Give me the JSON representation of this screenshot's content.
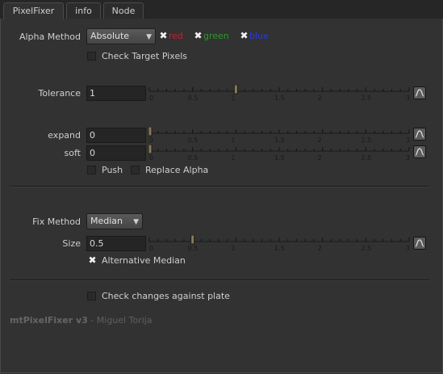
{
  "tabs": [
    {
      "label": "PixelFixer",
      "active": true
    },
    {
      "label": "info",
      "active": false
    },
    {
      "label": "Node",
      "active": false
    }
  ],
  "alpha_method": {
    "label": "Alpha Method",
    "value": "Absolute",
    "channels": [
      {
        "label": "red",
        "checked": true,
        "color": "#c8202a"
      },
      {
        "label": "green",
        "checked": true,
        "color": "#2a9a2a"
      },
      {
        "label": "blue",
        "checked": true,
        "color": "#2a3ad8"
      }
    ]
  },
  "check_target_pixels": {
    "label": "Check Target Pixels",
    "checked": false
  },
  "tolerance": {
    "label": "Tolerance",
    "value": "1"
  },
  "expand": {
    "label": "expand",
    "value": "0"
  },
  "soft": {
    "label": "soft",
    "value": "0"
  },
  "push": {
    "label": "Push",
    "checked": false
  },
  "replace_alpha": {
    "label": "Replace Alpha",
    "checked": false
  },
  "fix_method": {
    "label": "Fix Method",
    "value": "Median"
  },
  "size": {
    "label": "Size",
    "value": "0.5"
  },
  "alternative_median": {
    "label": "Alternative Median",
    "checked": true
  },
  "check_changes": {
    "label": "Check changes against plate",
    "checked": false
  },
  "footer": {
    "title": "mtPixelFixer v3",
    "author": " - Miguel Torija"
  },
  "slider_ticks": [
    "0",
    "0.5",
    "1",
    "1.5",
    "2",
    "2.5",
    "3"
  ],
  "slider_range": [
    0,
    3
  ],
  "colors": {
    "handle": "#8a7a5a",
    "background": "#323232"
  }
}
